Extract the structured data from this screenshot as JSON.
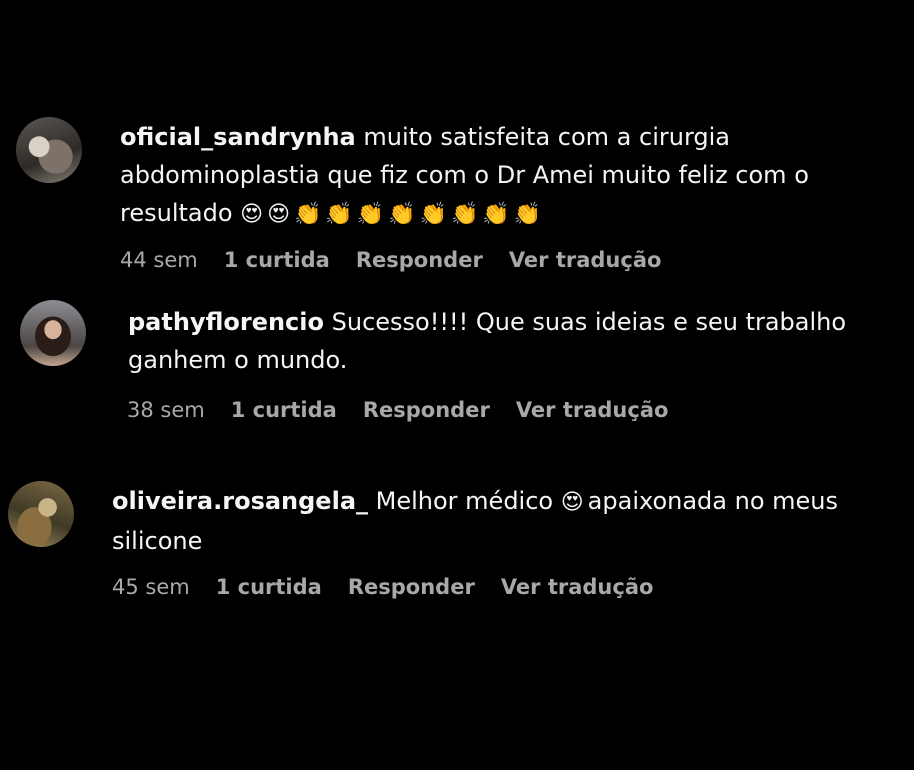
{
  "comments": [
    {
      "username": "oficial_sandrynha",
      "text": " muito satisfeita com a cirurgia abdominoplastia que fiz com o Dr Amei muito feliz com o resultado ",
      "emojis": "😍😍👏👏👏👏👏👏👏👏",
      "time": "44 sem",
      "likes": "1 curtida",
      "reply": "Responder",
      "translate": "Ver tradução"
    },
    {
      "username": "pathyflorencio",
      "text": " Sucesso!!!! Que suas ideias e seu trabalho ganhem o mundo.",
      "time": "38 sem",
      "likes": "1 curtida",
      "reply": "Responder",
      "translate": "Ver tradução"
    },
    {
      "username": "oliveira.rosangela_",
      "text_before": " Melhor médico ",
      "emoji": "😍",
      "text_after": "apaixonada no meus silicone",
      "time": "45 sem",
      "likes": "1 curtida",
      "reply": "Responder",
      "translate": "Ver tradução"
    }
  ]
}
